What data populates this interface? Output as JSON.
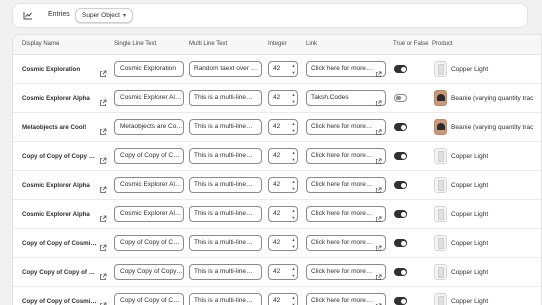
{
  "toolbar": {
    "entries_icon": "chart-icon",
    "entries_label": "Entries",
    "type_selected": "Super Object"
  },
  "table": {
    "columns": [
      "Display Name",
      "Single Line Text",
      "Multi Line Text",
      "Integer",
      "Link",
      "True or False",
      "Product"
    ],
    "rows": [
      {
        "display_name": "Cosmic Exploration",
        "single": "Cosmic Exploration",
        "multi": "Random taext over m…",
        "integer": "42",
        "link": "Click here for more i…",
        "toggle": true,
        "product": "Copper Light",
        "thumb": "lamp"
      },
      {
        "display_name": "Cosmic Explorer Alpha",
        "single": "Cosmic Explorer Alpha",
        "multi": "This is a multi-line…",
        "integer": "42",
        "link": "Taksh.Codes",
        "toggle": false,
        "product": "Beanie (varying quantity trac",
        "thumb": "beanie"
      },
      {
        "display_name": "Metaobjects are Cool!",
        "single": "Metaobjects are Cool!",
        "multi": "This is a multi-line…",
        "integer": "42",
        "link": "Click here for more i…",
        "toggle": true,
        "product": "Beanie (varying quantity trac",
        "thumb": "beanie"
      },
      {
        "display_name": "Copy of Copy of Copy of …",
        "single": "Copy of Copy of Copy o",
        "multi": "This is a multi-line…",
        "integer": "42",
        "link": "Click here for more i…",
        "toggle": true,
        "product": "Copper Light",
        "thumb": "lamp"
      },
      {
        "display_name": "Cosmic Explorer Alpha",
        "single": "Cosmic Explorer Alpha",
        "multi": "This is a multi-line…",
        "integer": "42",
        "link": "Click here for more i…",
        "toggle": true,
        "product": "Copper Light",
        "thumb": "lamp"
      },
      {
        "display_name": "Cosmic Explorer Alpha",
        "single": "Cosmic Explorer Alpha",
        "multi": "This is a multi-line…",
        "integer": "42",
        "link": "Click here for more i…",
        "toggle": true,
        "product": "Copper Light",
        "thumb": "lamp"
      },
      {
        "display_name": "Copy of Copy of Cosmic E…",
        "single": "Copy of Copy of Cosm",
        "multi": "This is a multi-line…",
        "integer": "42",
        "link": "Click here for more i…",
        "toggle": true,
        "product": "Copper Light",
        "thumb": "lamp"
      },
      {
        "display_name": "Copy Copy of Copy of Cos…",
        "single": "Copy Copy of Copy of",
        "multi": "This is a multi-line…",
        "integer": "42",
        "link": "Click here for more i…",
        "toggle": true,
        "product": "Copper Light",
        "thumb": "lamp"
      },
      {
        "display_name": "Copy of Copy of Cosmic E…",
        "single": "Copy of Copy of Cosm",
        "multi": "This is a multi-line…",
        "integer": "42",
        "link": "Click here for more i…",
        "toggle": true,
        "product": "Copper Light",
        "thumb": "lamp"
      }
    ]
  },
  "colors": {
    "toggle_on": "#303030",
    "page_bg": "#f1f1f1"
  }
}
